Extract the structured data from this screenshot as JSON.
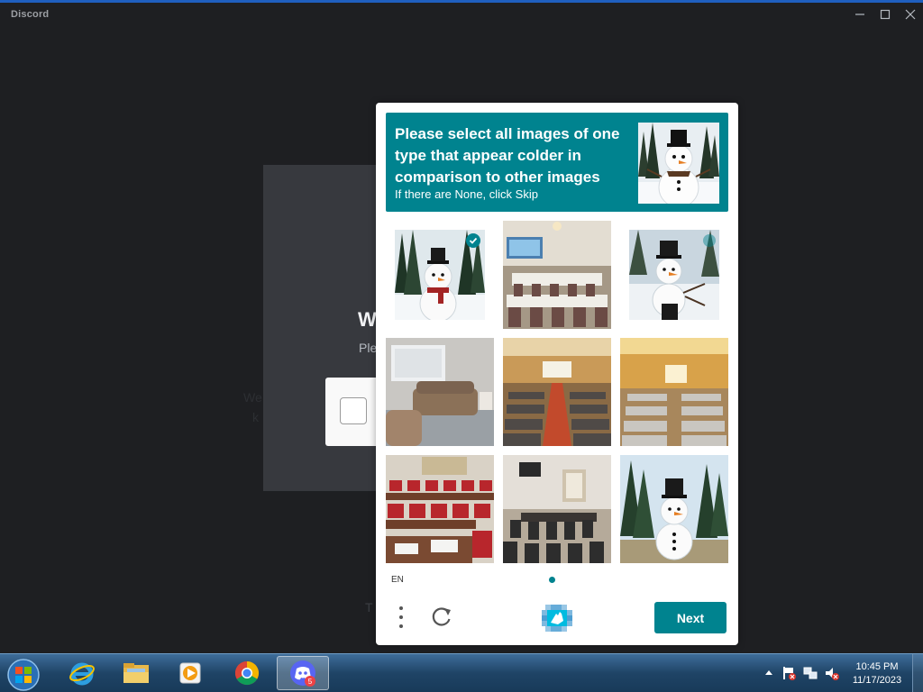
{
  "window": {
    "title": "Discord",
    "controls": [
      "minimize-icon",
      "maximize-icon",
      "close-icon"
    ]
  },
  "background": {
    "heading": "W",
    "subtext": "Ple",
    "ghost_line1": "We",
    "ghost_line2": "k",
    "footer_char": "T"
  },
  "captcha": {
    "prompt": "Please select all images of one type that appear colder in comparison to other images",
    "subprompt": "If there are None, click Skip",
    "prompt_image": "snowman-in-top-hat",
    "tiles": [
      {
        "subject": "snowman-in-forest",
        "selected": true
      },
      {
        "subject": "conference-room",
        "selected": false
      },
      {
        "subject": "snowman-with-stick-arms",
        "selected": false
      },
      {
        "subject": "living-room-sofa",
        "selected": false
      },
      {
        "subject": "conference-hall",
        "selected": false
      },
      {
        "subject": "auditorium-hall",
        "selected": false
      },
      {
        "subject": "meeting-room-red-chairs",
        "selected": false
      },
      {
        "subject": "empty-meeting-room",
        "selected": false
      },
      {
        "subject": "snowman-in-pine-forest",
        "selected": false
      }
    ],
    "language": "EN",
    "page_count": 1,
    "next_label": "Next",
    "accent_color": "#00838f"
  },
  "taskbar": {
    "apps": [
      "internet-explorer-icon",
      "file-explorer-icon",
      "media-player-icon",
      "chrome-icon",
      "discord-icon"
    ],
    "discord_badge": "5",
    "clock_time": "10:45 PM",
    "clock_date": "11/17/2023"
  }
}
